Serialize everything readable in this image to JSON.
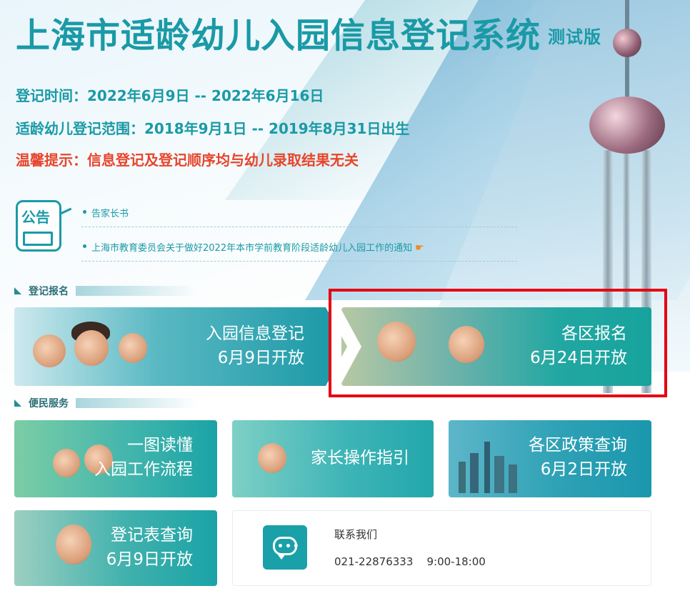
{
  "header": {
    "title": "上海市适龄幼儿入园信息登记系统",
    "tag": "测试版",
    "register_time": "登记时间：2022年6月9日 -- 2022年6月16日",
    "age_range": "适龄幼儿登记范围：2018年9月1日 -- 2019年8月31日出生",
    "tip": "温馨提示：信息登记及登记顺序均与幼儿录取结果无关"
  },
  "notice": {
    "icon_label": "公告",
    "items": [
      "告家长书",
      "上海市教育委员会关于做好2022年本市学前教育阶段适龄幼儿入园工作的通知"
    ]
  },
  "sections": {
    "register": "登记报名",
    "services": "便民服务"
  },
  "cards": {
    "register": {
      "line1": "入园信息登记",
      "line2": "6月9日开放"
    },
    "district": {
      "line1": "各区报名",
      "line2": "6月24日开放"
    },
    "guide": {
      "line1": "一图读懂",
      "line2": "入园工作流程"
    },
    "ops": {
      "line1": "家长操作指引"
    },
    "policy": {
      "line1": "各区政策查询",
      "line2": "6月2日开放"
    },
    "form": {
      "line1": "登记表查询",
      "line2": "6月9日开放"
    }
  },
  "contact": {
    "title": "联系我们",
    "phone": "021-22876333",
    "hours": "9:00-18:00"
  },
  "colors": {
    "brand": "#1a9aa6",
    "warning": "#e8452c",
    "highlight": "#e60012"
  }
}
